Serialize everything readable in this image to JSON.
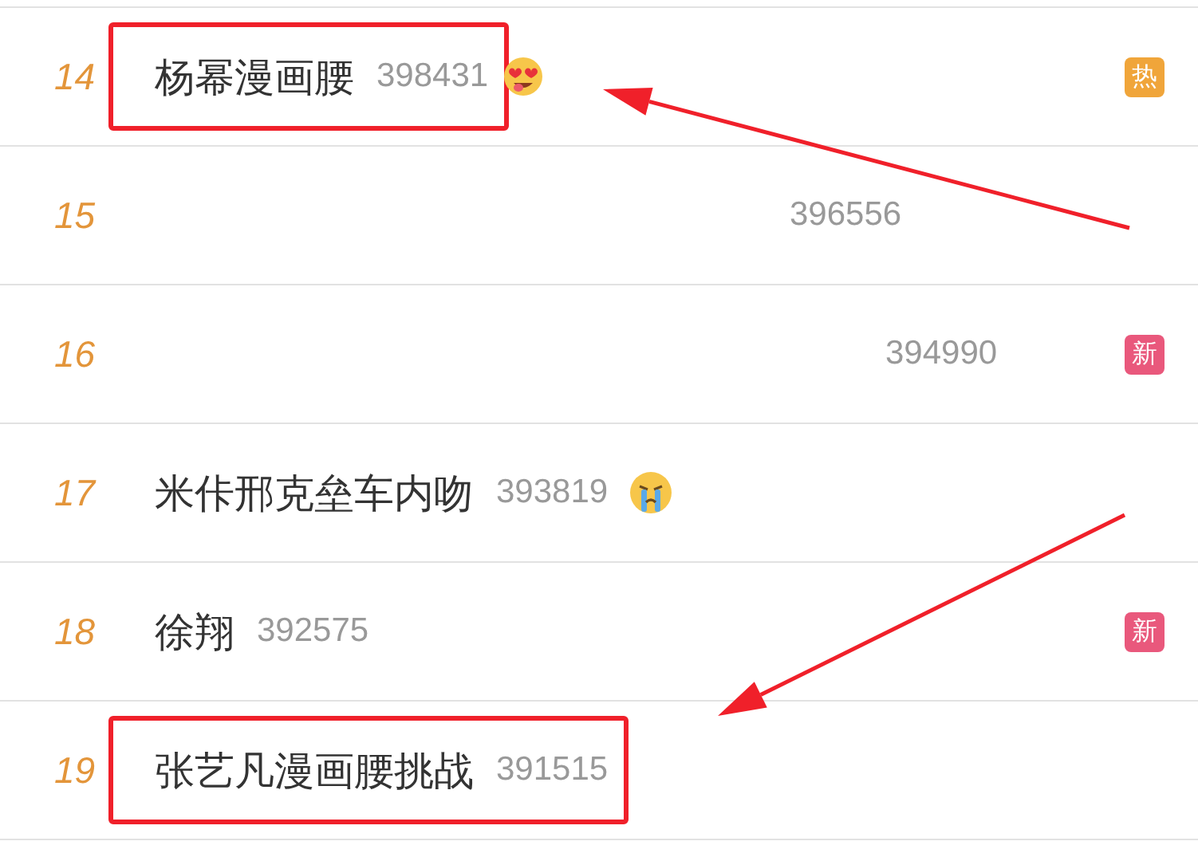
{
  "rows": [
    {
      "rank": "14",
      "title": "杨幂漫画腰",
      "count": "398431",
      "emoji": {
        "kind": "heart_eyes"
      },
      "badge": {
        "text": "热",
        "color": "#f0a53a"
      },
      "highlighted": true
    },
    {
      "rank": "15",
      "kind": "redacted",
      "count": "396556",
      "highlighted": false
    },
    {
      "rank": "16",
      "kind": "redacted",
      "count": "394990",
      "badge": {
        "text": "新",
        "color": "#e9587c"
      },
      "highlighted": false
    },
    {
      "rank": "17",
      "title": "米佧邢克垒车内吻",
      "count": "393819",
      "emoji": {
        "kind": "crying"
      },
      "highlighted": false
    },
    {
      "rank": "18",
      "title": "徐翔",
      "count": "392575",
      "badge": {
        "text": "新",
        "color": "#e9587c"
      },
      "highlighted": false
    },
    {
      "rank": "19",
      "title": "张艺凡漫画腰挑战",
      "count": "391515",
      "highlighted": true
    }
  ]
}
